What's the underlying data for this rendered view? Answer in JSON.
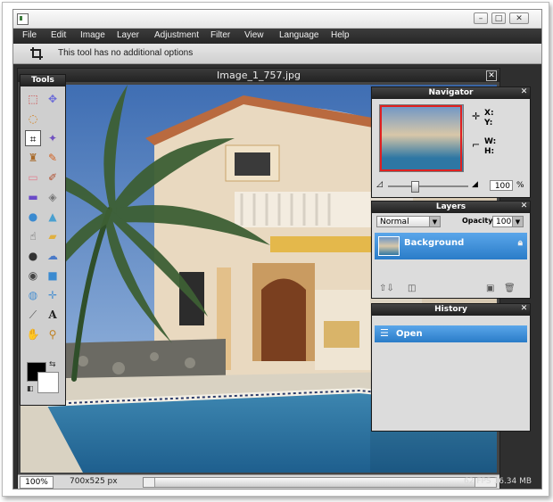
{
  "menu": [
    "File",
    "Edit",
    "Image",
    "Layer",
    "Adjustment",
    "Filter",
    "View",
    "Language",
    "Help"
  ],
  "options_bar": {
    "message": "This tool has no additional options"
  },
  "image_window": {
    "title": "Image_1_757.jpg",
    "zoom": "100%",
    "dimensions": "700x525 px"
  },
  "file_info": "62 FPS 16.34 MB",
  "tools_panel": {
    "title": "Tools",
    "tools": [
      "marquee-icon",
      "move-icon",
      "lasso-icon",
      "crop-icon",
      "magic-wand-icon",
      "stamp-icon",
      "pencil-icon",
      "eraser-icon",
      "brush-icon",
      "rectangle-icon",
      "bucket-icon",
      "drop-icon",
      "triangle-icon",
      "smudge-icon",
      "sponge-icon",
      "bomb-icon",
      "blob-icon",
      "eye-icon",
      "square-icon",
      "globe-icon",
      "expand-icon",
      "eyedropper-icon",
      "text-icon",
      "hand-icon",
      "zoom-icon"
    ],
    "active_tool": "crop-icon",
    "foreground_color": "#000000",
    "background_color": "#ffffff"
  },
  "navigator": {
    "title": "Navigator",
    "x_label": "X:",
    "y_label": "Y:",
    "w_label": "W:",
    "h_label": "H:",
    "zoom_value": "100",
    "zoom_unit": "%",
    "zoom_level": 0.3
  },
  "layers": {
    "title": "Layers",
    "blend_mode": "Normal",
    "opacity_label": "Opacity:",
    "opacity_value": "100",
    "items": [
      {
        "name": "Background",
        "locked": true
      }
    ]
  },
  "history": {
    "title": "History",
    "items": [
      {
        "name": "Open"
      }
    ]
  }
}
